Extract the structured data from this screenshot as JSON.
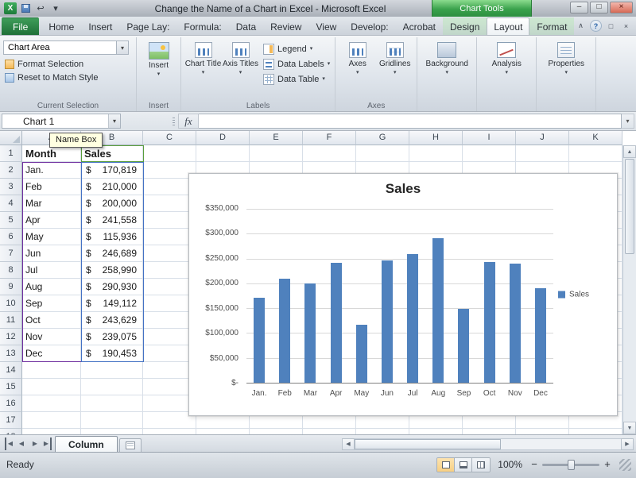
{
  "window": {
    "title": "Change the Name of a Chart in Excel  -  Microsoft Excel",
    "chart_tools": "Chart Tools"
  },
  "icons": {
    "chevron_down": "▾",
    "chevron_up": "∧",
    "undo": "↩",
    "minimize": "–",
    "maximize": "□",
    "close": "×",
    "help": "?",
    "scroll_left": "◀",
    "scroll_right": "▶",
    "scroll_up": "▲",
    "scroll_down": "▼",
    "excel_logo": "X"
  },
  "tabs": [
    {
      "label": "File",
      "file": true
    },
    {
      "label": "Home"
    },
    {
      "label": "Insert"
    },
    {
      "label": "Page Lay:"
    },
    {
      "label": "Formula:"
    },
    {
      "label": "Data"
    },
    {
      "label": "Review"
    },
    {
      "label": "View"
    },
    {
      "label": "Develop:"
    },
    {
      "label": "Acrobat"
    },
    {
      "label": "Design",
      "contextual": true
    },
    {
      "label": "Layout",
      "contextual": true,
      "active": true
    },
    {
      "label": "Format",
      "contextual": true
    }
  ],
  "ribbon": {
    "current_selection": {
      "combo_value": "Chart Area",
      "format_selection": "Format Selection",
      "reset": "Reset to Match Style",
      "group_label": "Current Selection"
    },
    "insert": {
      "label": "Insert",
      "group_label": "Insert"
    },
    "labels": {
      "chart_title": "Chart Title",
      "axis_titles": "Axis Titles",
      "legend": "Legend",
      "data_labels": "Data Labels",
      "data_table": "Data Table",
      "group_label": "Labels"
    },
    "axes": {
      "axes": "Axes",
      "gridlines": "Gridlines",
      "group_label": "Axes"
    },
    "background": {
      "label": "Background"
    },
    "analysis": {
      "label": "Analysis"
    },
    "properties": {
      "label": "Properties"
    }
  },
  "formula_bar": {
    "name_box": "Chart 1",
    "fx": "fx",
    "tooltip": "Name Box"
  },
  "sheet": {
    "columns": [
      "A",
      "B",
      "C",
      "D",
      "E",
      "F",
      "G",
      "H",
      "I",
      "J",
      "K"
    ],
    "header": [
      "Month",
      "Sales"
    ],
    "currency_symbol": "$",
    "visible_rows": 18,
    "data": [
      {
        "month": "Jan.",
        "amount": "170,819"
      },
      {
        "month": "Feb",
        "amount": "210,000"
      },
      {
        "month": "Mar",
        "amount": "200,000"
      },
      {
        "month": "Apr",
        "amount": "241,558"
      },
      {
        "month": "May",
        "amount": "115,936"
      },
      {
        "month": "Jun",
        "amount": "246,689"
      },
      {
        "month": "Jul",
        "amount": "258,990"
      },
      {
        "month": "Aug",
        "amount": "290,930"
      },
      {
        "month": "Sep",
        "amount": "149,112"
      },
      {
        "month": "Oct",
        "amount": "243,629"
      },
      {
        "month": "Nov",
        "amount": "239,075"
      },
      {
        "month": "Dec",
        "amount": "190,453"
      }
    ]
  },
  "chart_data": {
    "type": "bar",
    "title": "Sales",
    "series_name": "Sales",
    "categories": [
      "Jan.",
      "Feb",
      "Mar",
      "Apr",
      "May",
      "Jun",
      "Jul",
      "Aug",
      "Sep",
      "Oct",
      "Nov",
      "Dec"
    ],
    "values": [
      170819,
      210000,
      200000,
      241558,
      115936,
      246689,
      258990,
      290930,
      149112,
      243629,
      239075,
      190453
    ],
    "y_ticks": [
      "$350,000",
      "$300,000",
      "$250,000",
      "$200,000",
      "$150,000",
      "$100,000",
      "$50,000",
      "$-"
    ],
    "ylim": [
      0,
      350000
    ],
    "bar_color": "#4f81bd",
    "grid": true,
    "legend_position": "right"
  },
  "tabbar": {
    "sheet_name": "Column"
  },
  "statusbar": {
    "ready": "Ready",
    "zoom": "100%"
  }
}
